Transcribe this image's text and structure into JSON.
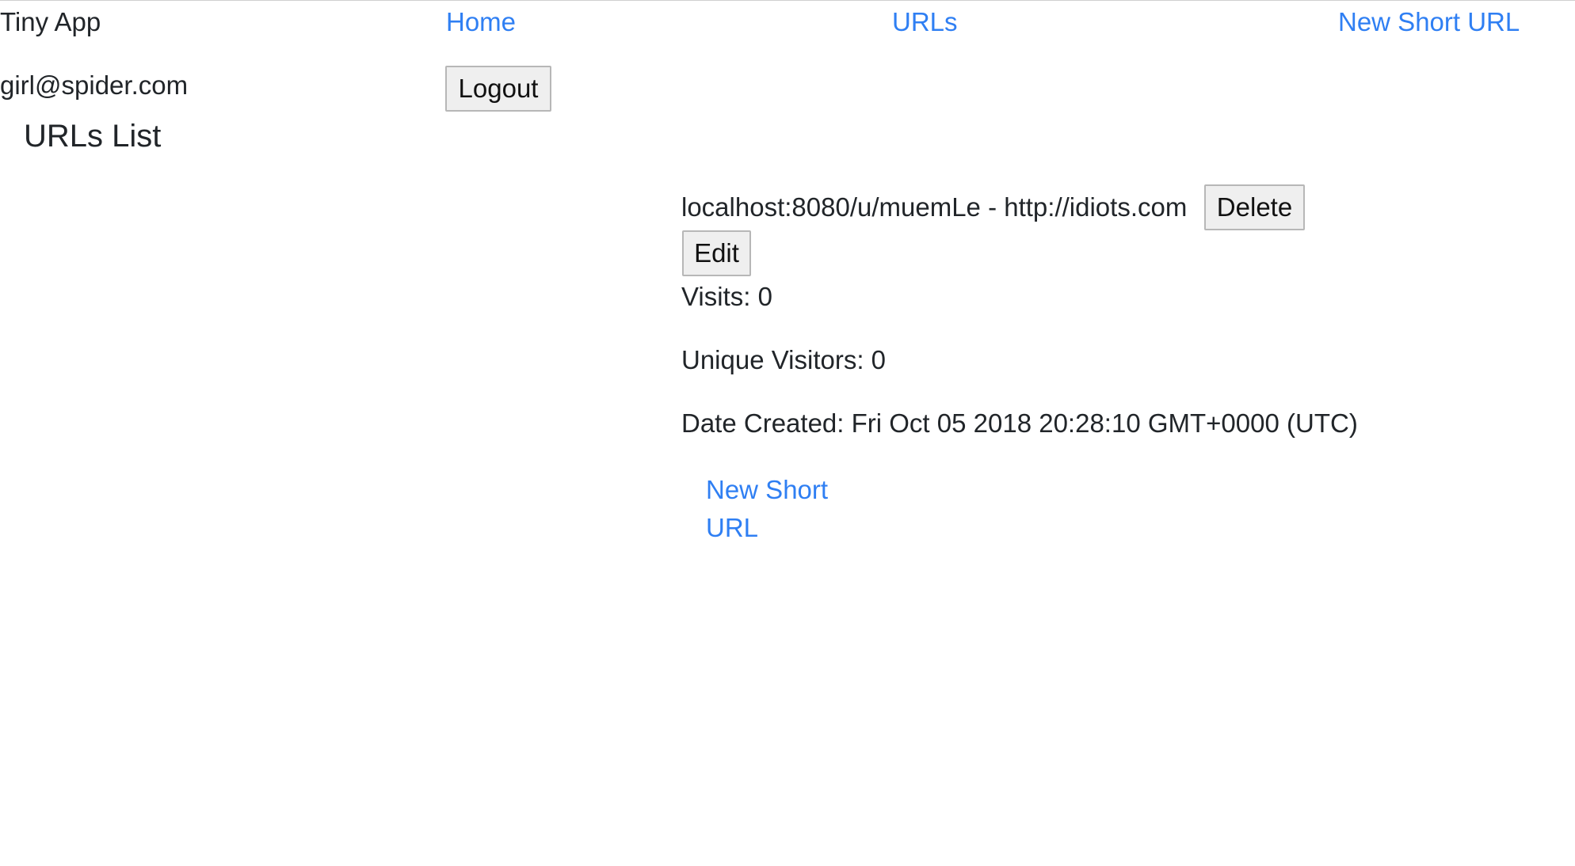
{
  "nav": {
    "brand": "Tiny App",
    "home": "Home",
    "urls": "URLs",
    "new_short_url": "New Short URL"
  },
  "user": {
    "email": "girl@spider.com",
    "logout_label": "Logout"
  },
  "page_title": "URLs List",
  "url_entry": {
    "short_url": "localhost:8080/u/muemLe",
    "separator": " - ",
    "long_url": "http://idiots.com",
    "delete_label": "Delete",
    "edit_label": "Edit",
    "visits": "Visits: 0",
    "unique_visitors": "Unique Visitors: 0",
    "date_created": "Date Created: Fri Oct 05 2018 20:28:10 GMT+0000 (UTC)"
  },
  "footer_link": "New Short URL"
}
